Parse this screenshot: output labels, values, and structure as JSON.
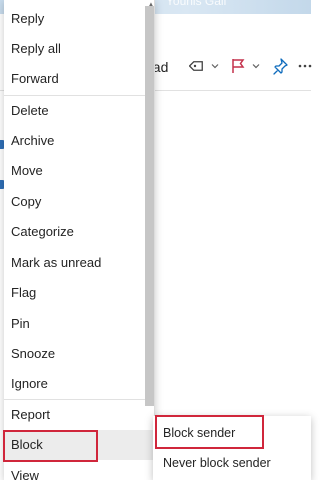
{
  "background": {
    "banner_text": "Younis Gali",
    "read_label": "ead",
    "tag_icon": "tag-icon",
    "flag_icon": "flag-icon",
    "pin_icon": "pin-icon",
    "colors": {
      "flag": "#c4314b",
      "pin": "#0f6cbd",
      "dot": "#2f6fb7"
    }
  },
  "menu": {
    "items": [
      {
        "label": "Reply"
      },
      {
        "label": "Reply all"
      },
      {
        "label": "Forward"
      },
      {
        "label": "Delete"
      },
      {
        "label": "Archive"
      },
      {
        "label": "Move"
      },
      {
        "label": "Copy"
      },
      {
        "label": "Categorize"
      },
      {
        "label": "Mark as unread"
      },
      {
        "label": "Flag"
      },
      {
        "label": "Pin"
      },
      {
        "label": "Snooze"
      },
      {
        "label": "Ignore"
      },
      {
        "label": "Report"
      },
      {
        "label": "Block"
      },
      {
        "label": "View"
      }
    ],
    "highlight_color": "#d0263b"
  },
  "submenu": {
    "items": [
      {
        "label": "Block sender"
      },
      {
        "label": "Never block sender"
      }
    ]
  }
}
